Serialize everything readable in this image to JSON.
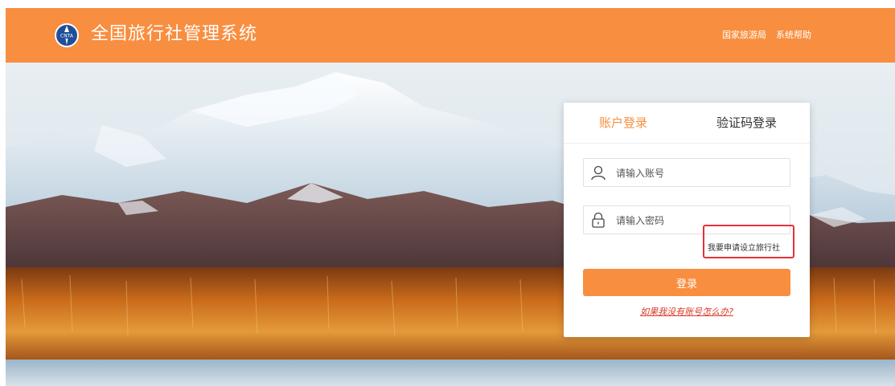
{
  "header": {
    "logo_text": "CNTA",
    "title": "全国旅行社管理系统",
    "links": [
      "国家旅游局",
      "系统帮助"
    ]
  },
  "login": {
    "tabs": [
      {
        "label": "账户登录",
        "active": true
      },
      {
        "label": "验证码登录",
        "active": false
      }
    ],
    "account_placeholder": "请输入账号",
    "password_placeholder": "请输入密码",
    "apply_link": "我要申请设立旅行社",
    "submit_label": "登录",
    "help_link": "如果我没有账号怎么办?"
  },
  "colors": {
    "accent": "#f88e3f",
    "highlight_box": "#e4323a",
    "help_link": "#d93a2a"
  }
}
